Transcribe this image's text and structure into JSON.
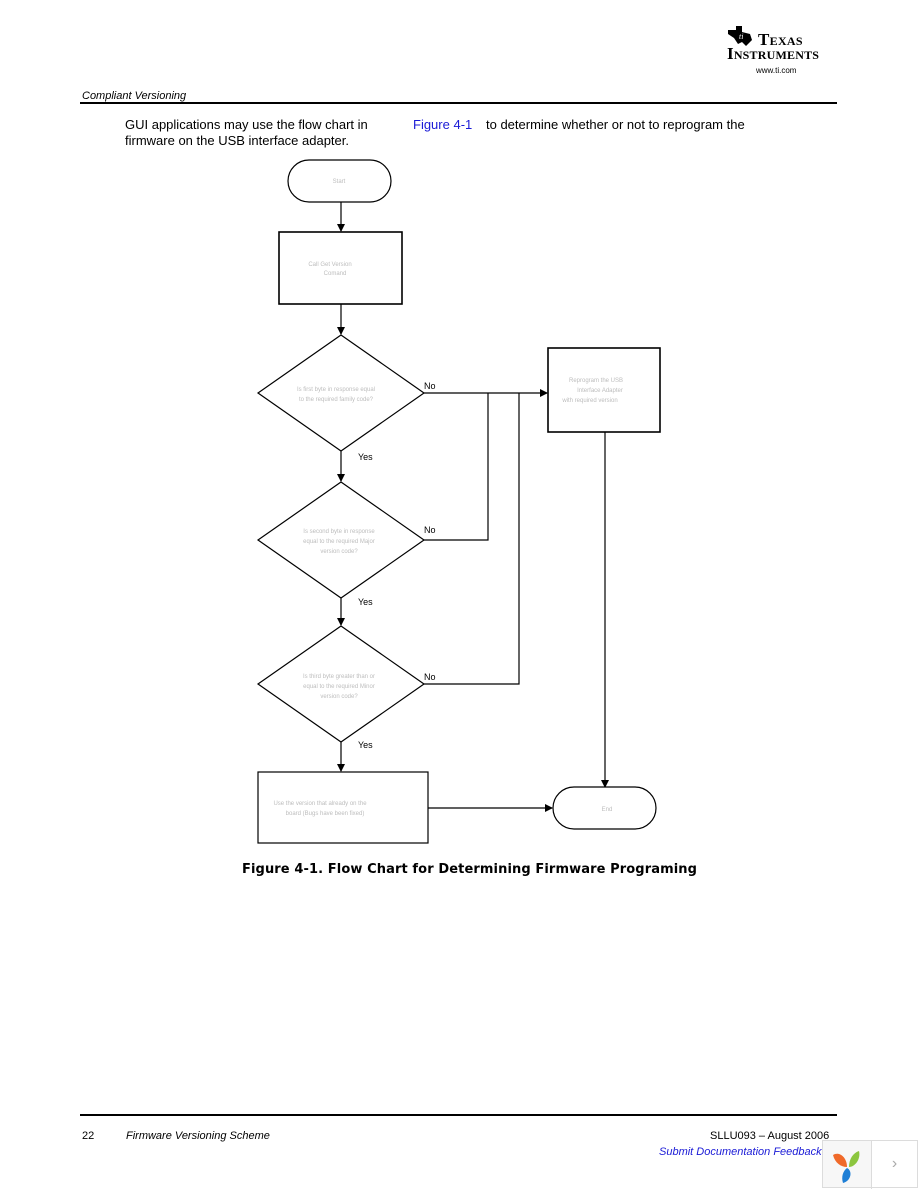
{
  "header": {
    "brand_line1": "Texas",
    "brand_line2": "Instruments",
    "brand_url": "www.ti.com",
    "section_title": "Compliant Versioning"
  },
  "intro": {
    "text_before_link": "GUI applications may use the flow chart in",
    "link_text": "Figure 4-1",
    "text_after_link": "to determine whether or not to reprogram the",
    "text_line2": "firmware on the USB interface adapter."
  },
  "flowchart": {
    "start": "Start",
    "step1": [
      "Call Get Version",
      "Comand"
    ],
    "decision1": [
      "Is first byte in response equal",
      "to the required family code?"
    ],
    "decision2": [
      "Is second byte in response",
      "equal to the required Major",
      "version code?"
    ],
    "decision3": [
      "Is third byte greater than or",
      "equal to the required Minor",
      "version code?"
    ],
    "reprogram": [
      "Reprogram the USB",
      "Interface Adapter",
      "with required version"
    ],
    "use_existing": [
      "Use the version that already on the",
      "board (Bugs have been fixed)"
    ],
    "end": "End",
    "yes_label": "Yes",
    "no_label": "No",
    "caption": "Figure 4-1. Flow Chart for Determining Firmware Programing"
  },
  "footer": {
    "page_number": "22",
    "doc_title": "Firmware Versioning Scheme",
    "doc_id": "SLLU093 – August 2006",
    "feedback_link": "Submit Documentation Feedback"
  },
  "widget": {
    "next_glyph": "›"
  }
}
